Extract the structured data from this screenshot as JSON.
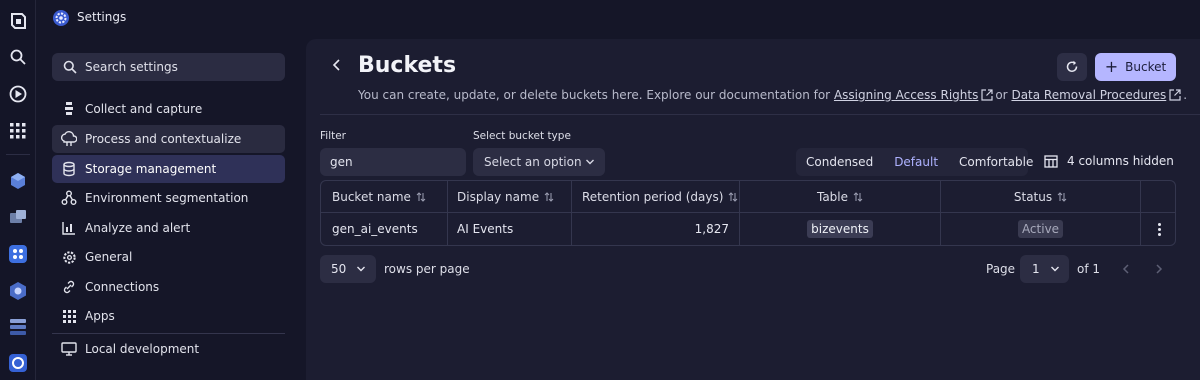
{
  "app": {
    "title": "Settings"
  },
  "rail": {
    "icons": [
      "dynatrace-logo-icon",
      "search-icon",
      "launcher-icon",
      "apps-grid-icon",
      "app-icon",
      "app-icon",
      "app-icon",
      "app-icon",
      "app-icon",
      "app-icon"
    ]
  },
  "sidebar": {
    "search_label": "Search settings",
    "items": [
      {
        "label": "Collect and capture",
        "icon": "collect-icon"
      },
      {
        "label": "Process and contextualize",
        "icon": "process-icon"
      },
      {
        "label": "Storage management",
        "icon": "storage-icon"
      },
      {
        "label": "Environment segmentation",
        "icon": "segmentation-icon"
      },
      {
        "label": "Analyze and alert",
        "icon": "analyze-icon"
      },
      {
        "label": "General",
        "icon": "gear-icon"
      },
      {
        "label": "Connections",
        "icon": "connections-icon"
      },
      {
        "label": "Apps",
        "icon": "apps-grid-icon"
      },
      {
        "label": "Local development",
        "icon": "monitor-icon"
      }
    ]
  },
  "page": {
    "title": "Buckets",
    "subtitle_prefix": "You can create, update, or delete buckets here. Explore our documentation for",
    "link_access": "Assigning Access Rights",
    "subtitle_or": "or",
    "link_removal": "Data Removal Procedures",
    "subtitle_suffix": ".",
    "add_button": "Bucket"
  },
  "filters": {
    "filter_label": "Filter",
    "filter_value": "gen",
    "type_label": "Select bucket type",
    "type_placeholder": "Select an option"
  },
  "density": {
    "options": [
      "Condensed",
      "Default",
      "Comfortable"
    ],
    "selected": "Default"
  },
  "columns_hidden": "4 columns hidden",
  "table": {
    "columns": [
      "Bucket name",
      "Display name",
      "Retention period (days)",
      "Table",
      "Status"
    ],
    "rows": [
      {
        "bucket_name": "gen_ai_events",
        "display_name": "AI Events",
        "retention": "1,827",
        "table": "bizevents",
        "status": "Active"
      }
    ]
  },
  "pagination": {
    "rows_per_page": "50",
    "rows_label": "rows per page",
    "page_label": "Page",
    "current_page": "1",
    "of_label": "of 1"
  },
  "colors": {
    "background": "#151628",
    "panel": "#1c1d31",
    "accent": "#b5b6ff",
    "active_nav": "#2f3158"
  }
}
